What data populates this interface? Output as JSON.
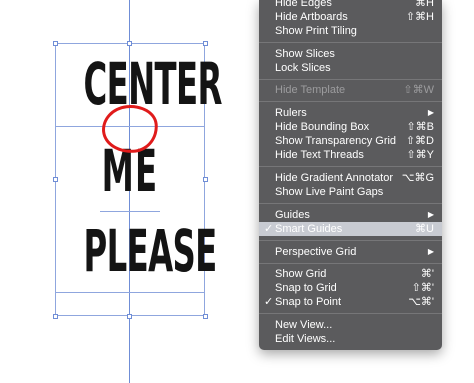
{
  "canvas": {
    "artwork_lines": [
      "CENTER",
      "ME",
      "PLEASE"
    ]
  },
  "menu": {
    "items": [
      {
        "label": "Hide Edges",
        "shortcut": "⌘H",
        "check": "",
        "submenu": false,
        "disabled": false,
        "selected": false
      },
      {
        "label": "Hide Artboards",
        "shortcut": "⇧⌘H",
        "check": "",
        "submenu": false,
        "disabled": false,
        "selected": false
      },
      {
        "label": "Show Print Tiling",
        "shortcut": "",
        "check": "",
        "submenu": false,
        "disabled": false,
        "selected": false
      },
      {
        "label": "Show Slices",
        "shortcut": "",
        "check": "",
        "submenu": false,
        "disabled": false,
        "selected": false
      },
      {
        "label": "Lock Slices",
        "shortcut": "",
        "check": "",
        "submenu": false,
        "disabled": false,
        "selected": false
      },
      {
        "label": "Hide Template",
        "shortcut": "⇧⌘W",
        "check": "",
        "submenu": false,
        "disabled": true,
        "selected": false
      },
      {
        "label": "Rulers",
        "shortcut": "▶",
        "check": "",
        "submenu": true,
        "disabled": false,
        "selected": false
      },
      {
        "label": "Hide Bounding Box",
        "shortcut": "⇧⌘B",
        "check": "",
        "submenu": false,
        "disabled": false,
        "selected": false
      },
      {
        "label": "Show Transparency Grid",
        "shortcut": "⇧⌘D",
        "check": "",
        "submenu": false,
        "disabled": false,
        "selected": false
      },
      {
        "label": "Hide Text Threads",
        "shortcut": "⇧⌘Y",
        "check": "",
        "submenu": false,
        "disabled": false,
        "selected": false
      },
      {
        "label": "Hide Gradient Annotator",
        "shortcut": "⌥⌘G",
        "check": "",
        "submenu": false,
        "disabled": false,
        "selected": false
      },
      {
        "label": "Show Live Paint Gaps",
        "shortcut": "",
        "check": "",
        "submenu": false,
        "disabled": false,
        "selected": false
      },
      {
        "label": "Guides",
        "shortcut": "▶",
        "check": "",
        "submenu": true,
        "disabled": false,
        "selected": false
      },
      {
        "label": "Smart Guides",
        "shortcut": "⌘U",
        "check": "✓",
        "submenu": false,
        "disabled": false,
        "selected": true
      },
      {
        "label": "Perspective Grid",
        "shortcut": "▶",
        "check": "",
        "submenu": true,
        "disabled": false,
        "selected": false
      },
      {
        "label": "Show Grid",
        "shortcut": "⌘'",
        "check": "",
        "submenu": false,
        "disabled": false,
        "selected": false
      },
      {
        "label": "Snap to Grid",
        "shortcut": "⇧⌘'",
        "check": "",
        "submenu": false,
        "disabled": false,
        "selected": false
      },
      {
        "label": "Snap to Point",
        "shortcut": "⌥⌘'",
        "check": "✓",
        "submenu": false,
        "disabled": false,
        "selected": false
      },
      {
        "label": "New View...",
        "shortcut": "",
        "check": "",
        "submenu": false,
        "disabled": false,
        "selected": false
      },
      {
        "label": "Edit Views...",
        "shortcut": "",
        "check": "",
        "submenu": false,
        "disabled": false,
        "selected": false
      }
    ]
  }
}
